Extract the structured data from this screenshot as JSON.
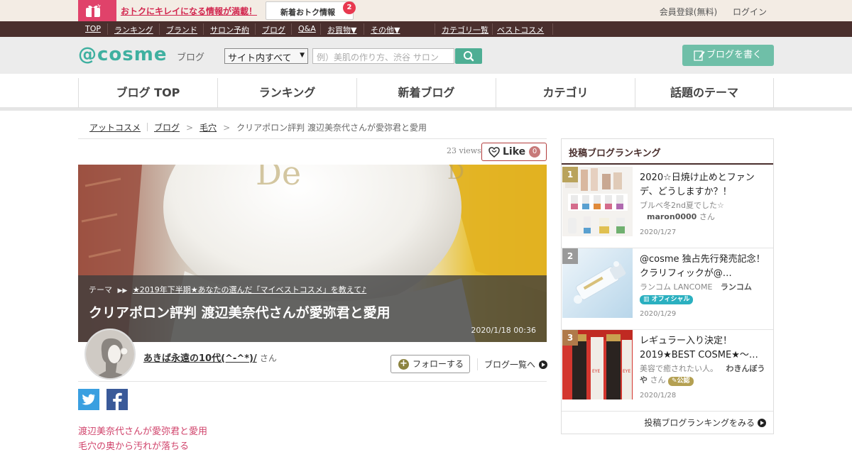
{
  "topbar": {
    "promo": "おトクにキレイになる情報が満載！",
    "news_label": "新着おトク情報",
    "news_count": "2",
    "register": "会員登録(無料)",
    "login": "ログイン"
  },
  "darknav": {
    "items": [
      "TOP",
      "ランキング",
      "ブランド",
      "サロン予約",
      "ブログ",
      "Q&A",
      "お買物▼",
      "その他▼"
    ],
    "right_items": [
      "カテゴリ一覧",
      "ベストコスメ"
    ]
  },
  "header": {
    "logo": "@cosme",
    "logo_sub": "ブログ",
    "search_scope": "サイト内すべて",
    "search_placeholder": "例）美肌の作り方、渋谷 サロン",
    "write_button": "ブログを書く"
  },
  "mainnav": {
    "tabs": [
      "ブログ TOP",
      "ランキング",
      "新着ブログ",
      "カテゴリ",
      "話題のテーマ"
    ]
  },
  "breadcrumb": {
    "items": [
      "アットコスメ",
      "ブログ",
      "毛穴"
    ],
    "current": "クリアポロン評判 渡辺美奈代さんが愛弥君と愛用"
  },
  "article": {
    "views": "23 views",
    "like_label": "Like",
    "like_count": "0",
    "theme_label": "テーマ",
    "theme_link": "★2019年下半期★あなたの選んだ「マイベストコスメ」を教えて♪",
    "title": "クリアポロン評判 渡辺美奈代さんが愛弥君と愛用",
    "date": "2020/1/18 00:36",
    "author": "あきば永遠の10代(^-^*)/",
    "author_suffix": "さん",
    "follow": "フォローする",
    "blog_list": "ブログ一覧へ",
    "body_lines": [
      "渡辺美奈代さんが愛弥君と愛用",
      "毛穴の奥から汚れが落ちる"
    ]
  },
  "sidebar": {
    "title": "投稿ブログランキング",
    "more": "投稿ブログランキングをみる",
    "items": [
      {
        "rank": "1",
        "title": "2020☆日焼け止めとファンデ、どうしますか？！",
        "author_desc": "ブルベ冬2nd夏でした☆",
        "author": "maron0000",
        "suffix": "さん",
        "badge": "",
        "date": "2020/1/27"
      },
      {
        "rank": "2",
        "title": "@cosme 独占先行発売記念！クラリフィックが@…",
        "author_desc": "ランコム LANCOME",
        "author": "ランコム",
        "suffix": "",
        "badge": "オフィシャル",
        "date": "2020/1/29"
      },
      {
        "rank": "3",
        "title": "レギュラー入り決定！2019★BEST COSME★～…",
        "author_desc": "美容で癒されたい人。",
        "author": "わきんぼうや",
        "suffix": "さん",
        "badge": "公認",
        "date": "2020/1/28"
      }
    ]
  },
  "colors": {
    "brand": "#3fb0a0",
    "dark_nav": "#4a2f2d",
    "accent_pink": "#d0436b",
    "rank1": "#b9a35c",
    "rank2": "#9a9a9a",
    "rank3": "#b07a4a"
  }
}
